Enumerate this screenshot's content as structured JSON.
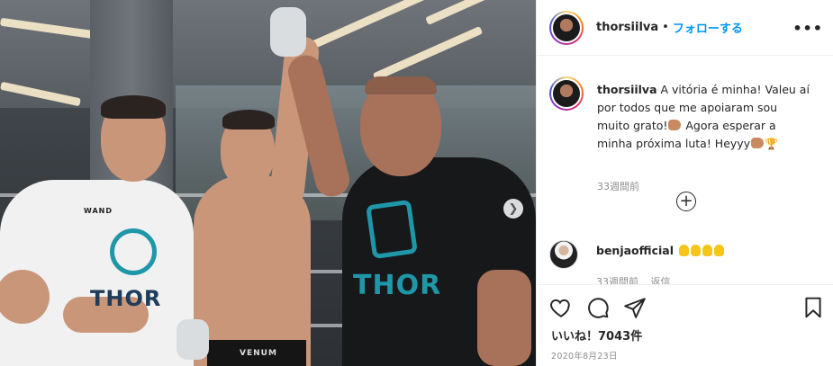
{
  "post": {
    "username": "thorsiilva",
    "follow_label": "フォローする",
    "dot": "•",
    "more_icon": "more-horizontal-icon"
  },
  "caption": {
    "username": "thorsiilva",
    "line1": "A vitória é minha! Valeu aí",
    "line2": "por todos que me apoiaram sou",
    "line3": "muito grato!",
    "line3b": " Agora esperar a",
    "line4": "minha próxima luta! Heyyy",
    "time": "33週間前"
  },
  "comment": {
    "username": "benjaofficial",
    "meta_time": "33週間前",
    "meta_reply": "返信"
  },
  "actions": {
    "likes_prefix": "いいね！",
    "likes_count": "7043件",
    "date": "2020年8月23日"
  },
  "photo": {
    "shirt_left_brand": "THOR",
    "shirt_left_small": "WAND",
    "shirt_right_brand": "THOR",
    "shorts_brand": "VENUM"
  },
  "colors": {
    "accent": "#0095f6",
    "text": "#262626",
    "muted": "#8e8e8e",
    "teal_logo": "#1f97a8"
  }
}
